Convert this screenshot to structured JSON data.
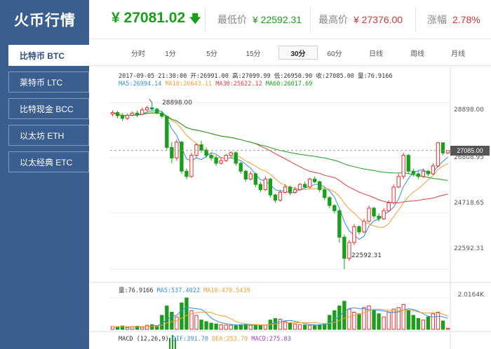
{
  "app": {
    "title": "火币行情"
  },
  "sidebar": {
    "items": [
      {
        "label": "比特币 BTC",
        "active": true
      },
      {
        "label": "莱特币 LTC",
        "active": false
      },
      {
        "label": "比特现金 BCC",
        "active": false
      },
      {
        "label": "以太坊 ETH",
        "active": false
      },
      {
        "label": "以太经典 ETC",
        "active": false
      }
    ]
  },
  "header": {
    "currency": "¥",
    "price": "27081.02",
    "low_label": "最低价",
    "low_value": "¥ 22592.31",
    "high_label": "最高价",
    "high_value": "¥ 27376.00",
    "change_label": "涨幅",
    "change_value": "2.78%"
  },
  "tabs": [
    "分时",
    "1分",
    "5分",
    "15分",
    "30分",
    "60分",
    "日线",
    "周线",
    "月线"
  ],
  "active_tab": "30分",
  "info": {
    "line1": "2017-09-05 21:30:00  开:26991.00 高:27099.99 低:26950.90 收:27085.00 量:76.9166",
    "ma5": "MA5:26994.14",
    "ma10": "MA10:26643.11",
    "ma30": "MA30:25622.12",
    "ma60": "MA60:26017.69",
    "vol": "量:76.9166",
    "vol_ma5": "MA5:537.4022",
    "vol_ma10": "MA10:470.5439",
    "macd": "MACD (12,26,9)",
    "dif": "DIF:391.70",
    "dea": "DEA:253.79",
    "macd_val": "MACD:275.83"
  },
  "axis": {
    "y_ticks": [
      "28898.00",
      "26808.95",
      "24718.65",
      "22592.31"
    ],
    "current_tag": "27085.00",
    "vol_tick": "2.0164K",
    "max_label": "28898.00",
    "min_label": "22592.31"
  },
  "colors": {
    "up": "#e03030",
    "down": "#1a9f1a",
    "sidebar": "#3a5f8f"
  },
  "chart_data": {
    "type": "candlestick",
    "period": "30分",
    "ylim": [
      22300,
      29200
    ],
    "max": 28898.0,
    "min": 22592.31,
    "candles": [
      [
        28460,
        28520,
        28600,
        28380
      ],
      [
        28520,
        28400,
        28580,
        28300
      ],
      [
        28400,
        28300,
        28500,
        28200
      ],
      [
        28300,
        28420,
        28480,
        28240
      ],
      [
        28420,
        28500,
        28560,
        28380
      ],
      [
        28500,
        28450,
        28600,
        28350
      ],
      [
        28450,
        28620,
        28700,
        28420
      ],
      [
        28620,
        28700,
        28780,
        28560
      ],
      [
        28700,
        28650,
        28898,
        28600
      ],
      [
        28650,
        28500,
        28700,
        28450
      ],
      [
        28500,
        28380,
        28560,
        28300
      ],
      [
        28380,
        27200,
        28400,
        27100
      ],
      [
        27200,
        26800,
        27400,
        26600
      ],
      [
        26800,
        27400,
        27500,
        26700
      ],
      [
        27400,
        26300,
        27450,
        26200
      ],
      [
        26300,
        26100,
        26400,
        26000
      ],
      [
        26100,
        26900,
        27000,
        26050
      ],
      [
        26900,
        27300,
        27350,
        26800
      ],
      [
        27300,
        27100,
        27450,
        27000
      ],
      [
        27100,
        26900,
        27200,
        26800
      ],
      [
        26900,
        26800,
        27000,
        26700
      ],
      [
        26800,
        26600,
        26900,
        26500
      ],
      [
        26600,
        26700,
        26800,
        26550
      ],
      [
        26700,
        26900,
        26950,
        26650
      ],
      [
        26900,
        27000,
        27050,
        26850
      ],
      [
        27000,
        26600,
        27050,
        26500
      ],
      [
        26600,
        26300,
        26650,
        26200
      ],
      [
        26300,
        26000,
        26350,
        25900
      ],
      [
        26000,
        26200,
        26300,
        25950
      ],
      [
        26200,
        25800,
        26250,
        25700
      ],
      [
        25800,
        25600,
        25900,
        25500
      ],
      [
        25600,
        26000,
        26100,
        25550
      ],
      [
        26000,
        25400,
        26050,
        25300
      ],
      [
        25400,
        25200,
        25450,
        25100
      ],
      [
        25200,
        25500,
        25600,
        25150
      ],
      [
        25500,
        25700,
        25800,
        25450
      ],
      [
        25700,
        25500,
        25750,
        25400
      ],
      [
        25500,
        25600,
        25700,
        25450
      ],
      [
        25600,
        25800,
        25850,
        25550
      ],
      [
        25800,
        25700,
        25900,
        25650
      ],
      [
        25700,
        26000,
        26050,
        25650
      ],
      [
        26000,
        25900,
        26100,
        25850
      ],
      [
        25900,
        25600,
        25950,
        25500
      ],
      [
        25600,
        25300,
        25650,
        25200
      ],
      [
        25300,
        25000,
        25350,
        24900
      ],
      [
        25000,
        24800,
        25050,
        24700
      ],
      [
        24800,
        23800,
        24850,
        23600
      ],
      [
        23800,
        23000,
        23900,
        22592
      ],
      [
        23000,
        23600,
        23700,
        22900
      ],
      [
        23600,
        24200,
        24300,
        23500
      ],
      [
        24200,
        24000,
        24250,
        23900
      ],
      [
        24000,
        24400,
        24500,
        23950
      ],
      [
        24400,
        24900,
        25000,
        24350
      ],
      [
        24900,
        24600,
        24950,
        24500
      ],
      [
        24600,
        24500,
        24700,
        24400
      ],
      [
        24500,
        24800,
        24900,
        24450
      ],
      [
        24800,
        25100,
        25200,
        24750
      ],
      [
        25100,
        25700,
        25800,
        25050
      ],
      [
        25700,
        26100,
        26200,
        25650
      ],
      [
        26100,
        26900,
        27000,
        26000
      ],
      [
        26900,
        26300,
        26950,
        26200
      ],
      [
        26300,
        26200,
        26400,
        26100
      ],
      [
        26200,
        26100,
        26300,
        26000
      ],
      [
        26100,
        26300,
        26400,
        26050
      ],
      [
        26300,
        26200,
        26350,
        26100
      ],
      [
        26200,
        26500,
        26600,
        26150
      ],
      [
        26500,
        27376,
        27400,
        26450
      ],
      [
        27376,
        26991,
        27380,
        26900
      ],
      [
        26991,
        27085,
        27100,
        26950
      ]
    ],
    "volumes": [
      180,
      150,
      220,
      120,
      160,
      200,
      140,
      260,
      300,
      240,
      900,
      1500,
      1100,
      800,
      1700,
      2016,
      1200,
      900,
      600,
      500,
      400,
      350,
      300,
      280,
      260,
      240,
      300,
      320,
      260,
      300,
      250,
      280,
      600,
      700,
      650,
      500,
      400,
      350,
      300,
      280,
      260,
      240,
      300,
      350,
      900,
      1200,
      1500,
      1800,
      1300,
      1100,
      1000,
      1400,
      1500,
      1200,
      1000,
      800,
      1100,
      1300,
      1400,
      1600,
      1200,
      900,
      700,
      600,
      800,
      1000,
      1100,
      540,
      77
    ]
  }
}
